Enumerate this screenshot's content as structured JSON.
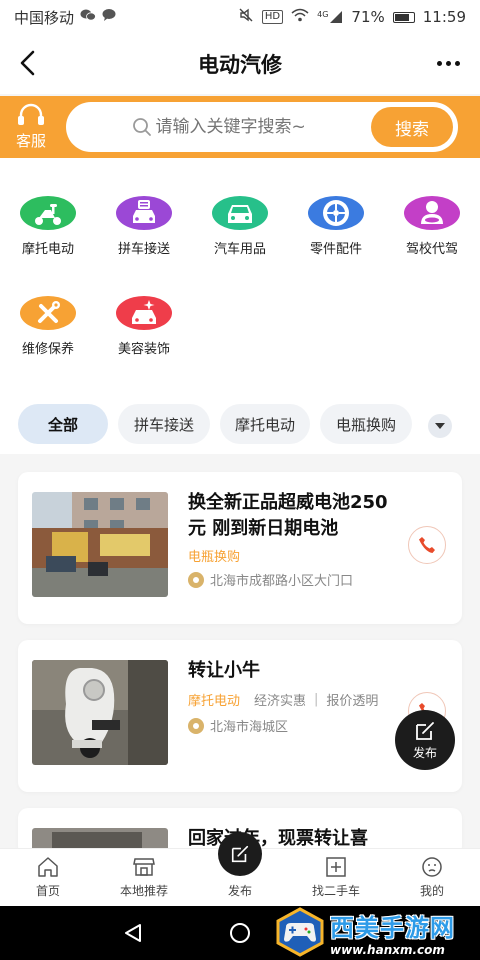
{
  "status_bar": {
    "carrier": "中国移动",
    "network": "4G",
    "hd": "HD",
    "battery": "71%",
    "time": "11:59"
  },
  "nav": {
    "title": "电动汽修"
  },
  "search": {
    "service_label": "客服",
    "placeholder": "请输入关键字搜索~",
    "button_label": "搜索"
  },
  "categories": [
    {
      "label": "摩托电动",
      "icon": "scooter-icon",
      "color": "#2dbd5f"
    },
    {
      "label": "拼车接送",
      "icon": "carpool-icon",
      "color": "#9b48d6"
    },
    {
      "label": "汽车用品",
      "icon": "car-icon",
      "color": "#27c08a"
    },
    {
      "label": "零件配件",
      "icon": "wheel-icon",
      "color": "#3b7be0"
    },
    {
      "label": "驾校代驾",
      "icon": "driver-icon",
      "color": "#c33fc7"
    },
    {
      "label": "维修保养",
      "icon": "tools-icon",
      "color": "#f7a234"
    },
    {
      "label": "美容装饰",
      "icon": "carwash-icon",
      "color": "#ef3d4a"
    }
  ],
  "filters": {
    "tabs": [
      "全部",
      "拼车接送",
      "摩托电动",
      "电瓶换购"
    ],
    "active_index": 0
  },
  "listings": [
    {
      "title": "换全新正品超威电池250元 刚到新日期电池",
      "tag": "电瓶换购",
      "location": "北海市成都路小区大门口"
    },
    {
      "title": "转让小牛",
      "tag": "摩托电动",
      "tag2": "经济实惠",
      "tag3": "报价透明",
      "location": "北海市海城区"
    },
    {
      "title": "回家过年，现票转让喜"
    }
  ],
  "fab": {
    "label": "发布"
  },
  "bottom_nav": {
    "items": [
      "首页",
      "本地推荐",
      "发布",
      "找二手车",
      "我的"
    ]
  },
  "watermark": {
    "title": "西美手游网",
    "url": "www.hanxm.com"
  }
}
